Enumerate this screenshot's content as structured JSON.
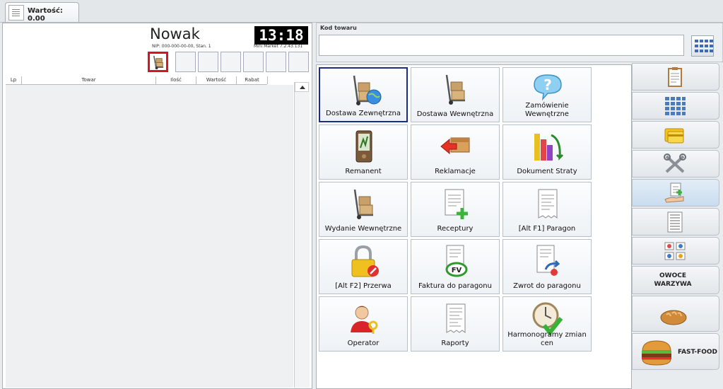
{
  "tab": {
    "label": "Wartość: 0.00"
  },
  "header": {
    "store_name": "Nowak",
    "nip_line": "NIP: 000-000-00-00, Stan. 1",
    "clock": "13:18",
    "version": "Mini Market 7.2.43.131"
  },
  "grid": {
    "columns": [
      "Lp",
      "Towar",
      "Ilość",
      "Wartość",
      "Rabat"
    ]
  },
  "code": {
    "label": "Kod towaru",
    "value": ""
  },
  "tiles": [
    {
      "label": "Dostawa Zewnętrzna",
      "icon": "trolley-globe-icon"
    },
    {
      "label": "Dostawa Wewnętrzna",
      "icon": "trolley-icon"
    },
    {
      "label": "Zamówienie Wewnętrzne",
      "icon": "question-bubble-icon"
    },
    {
      "label": "Remanent",
      "icon": "pda-icon"
    },
    {
      "label": "Reklamacje",
      "icon": "box-return-icon"
    },
    {
      "label": "Dokument Straty",
      "icon": "bars-down-icon"
    },
    {
      "label": "Wydanie Wewnętrzne",
      "icon": "trolley-icon"
    },
    {
      "label": "Receptury",
      "icon": "document-plus-icon"
    },
    {
      "label": "[Alt F1] Paragon",
      "icon": "receipt-icon"
    },
    {
      "label": "[Alt F2] Przerwa",
      "icon": "padlock-icon"
    },
    {
      "label": "Faktura do paragonu",
      "icon": "receipt-fv-icon"
    },
    {
      "label": "Zwrot do paragonu",
      "icon": "receipt-return-icon"
    },
    {
      "label": "Operator",
      "icon": "user-key-icon"
    },
    {
      "label": "Raporty",
      "icon": "report-icon"
    },
    {
      "label": "Harmonogramy zmian cen",
      "icon": "clock-check-icon"
    }
  ],
  "side_tabs": [
    {
      "icon": "clipboard-icon"
    },
    {
      "icon": "calculator-icon"
    },
    {
      "icon": "card-icon"
    },
    {
      "icon": "tools-icon"
    },
    {
      "icon": "hand-receipt-icon"
    },
    {
      "icon": "price-list-icon"
    },
    {
      "icon": "labels-icon"
    },
    {
      "label": "OWOCE WARZYWA"
    },
    {
      "icon": "bread-icon"
    },
    {
      "label": "FAST-FOOD",
      "icon": "burger-icon"
    }
  ],
  "colors": {
    "accent": "#1a2d8c",
    "highlight": "#d8141d",
    "clock_bg": "#000000"
  }
}
